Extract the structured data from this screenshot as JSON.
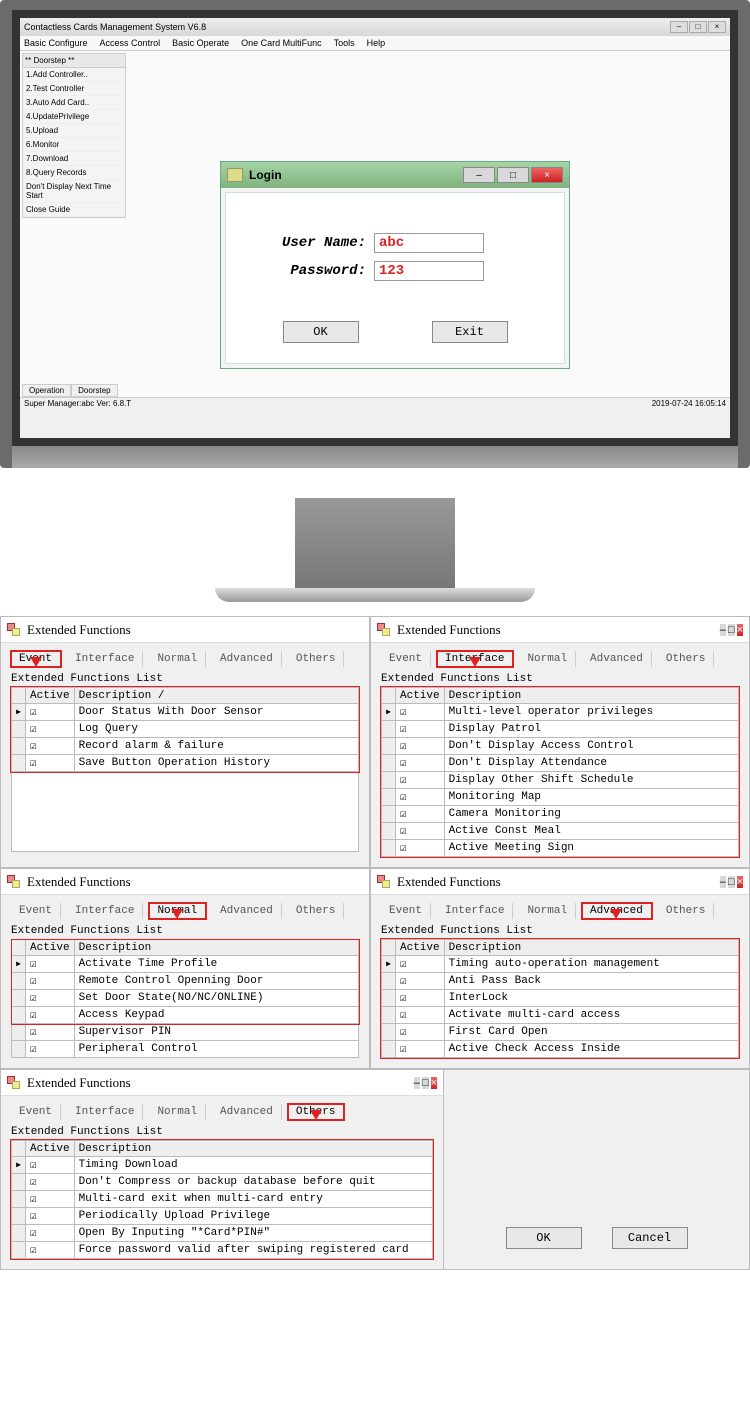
{
  "monitor": {
    "app_title": "Contactless Cards Management System  V6.8",
    "menu": [
      "Basic Configure",
      "Access Control",
      "Basic Operate",
      "One Card MultiFunc",
      "Tools",
      "Help"
    ],
    "sidebar_header": "** Doorstep **",
    "sidebar_items": [
      "1.Add Controller..",
      "2.Test Controller",
      "3.Auto Add Card..",
      "4.UpdatePrivilege",
      "5.Upload",
      "6.Monitor",
      "7.Download",
      "8.Query Records",
      "Don't Display Next Time Start",
      "Close Guide"
    ],
    "bottom_tabs": [
      "Operation",
      "Doorstep"
    ],
    "status_left": "Super Manager:abc    Ver: 6.8.T",
    "status_right": "2019-07-24 16:05:14"
  },
  "login": {
    "title": "Login",
    "user_label": "User Name:",
    "pass_label": "Password:",
    "user_value": "abc",
    "pass_value": "123",
    "ok": "OK",
    "exit": "Exit"
  },
  "ext_title": "Extended Functions",
  "list_title": "Extended Functions List",
  "hdr_active": "Active",
  "hdr_desc": "Description",
  "hdr_desc_sort": "Description /",
  "tabs": [
    "Event",
    "Interface",
    "Normal",
    "Advanced",
    "Others"
  ],
  "panels": {
    "event": {
      "rows": [
        "Door Status With Door Sensor",
        "Log Query",
        "Record alarm & failure",
        "Save Button Operation History"
      ]
    },
    "interface": {
      "rows": [
        "Multi-level operator privileges",
        "Display Patrol",
        "Don't Display Access Control",
        "Don't Display Attendance",
        "Display Other Shift Schedule",
        "Monitoring Map",
        "Camera Monitoring",
        "Active Const Meal",
        "Active Meeting Sign"
      ]
    },
    "normal": {
      "rows": [
        "Activate Time Profile",
        "Remote Control Openning Door",
        "Set Door State(NO/NC/ONLINE)",
        "Access Keypad",
        "Supervisor PIN",
        "Peripheral Control"
      ],
      "redbox_rows": 4
    },
    "advanced": {
      "rows": [
        "Timing auto-operation management",
        "Anti Pass Back",
        "InterLock",
        "Activate multi-card access",
        "First Card Open",
        "Active Check Access Inside"
      ]
    },
    "others": {
      "rows": [
        "Timing Download",
        "Don't Compress or backup database before quit",
        "Multi-card exit when multi-card entry",
        "Periodically Upload Privilege",
        "Open By Inputing \"*Card*PIN#\"",
        "Force password valid after swiping registered card"
      ]
    }
  },
  "footer": {
    "ok": "OK",
    "cancel": "Cancel"
  }
}
